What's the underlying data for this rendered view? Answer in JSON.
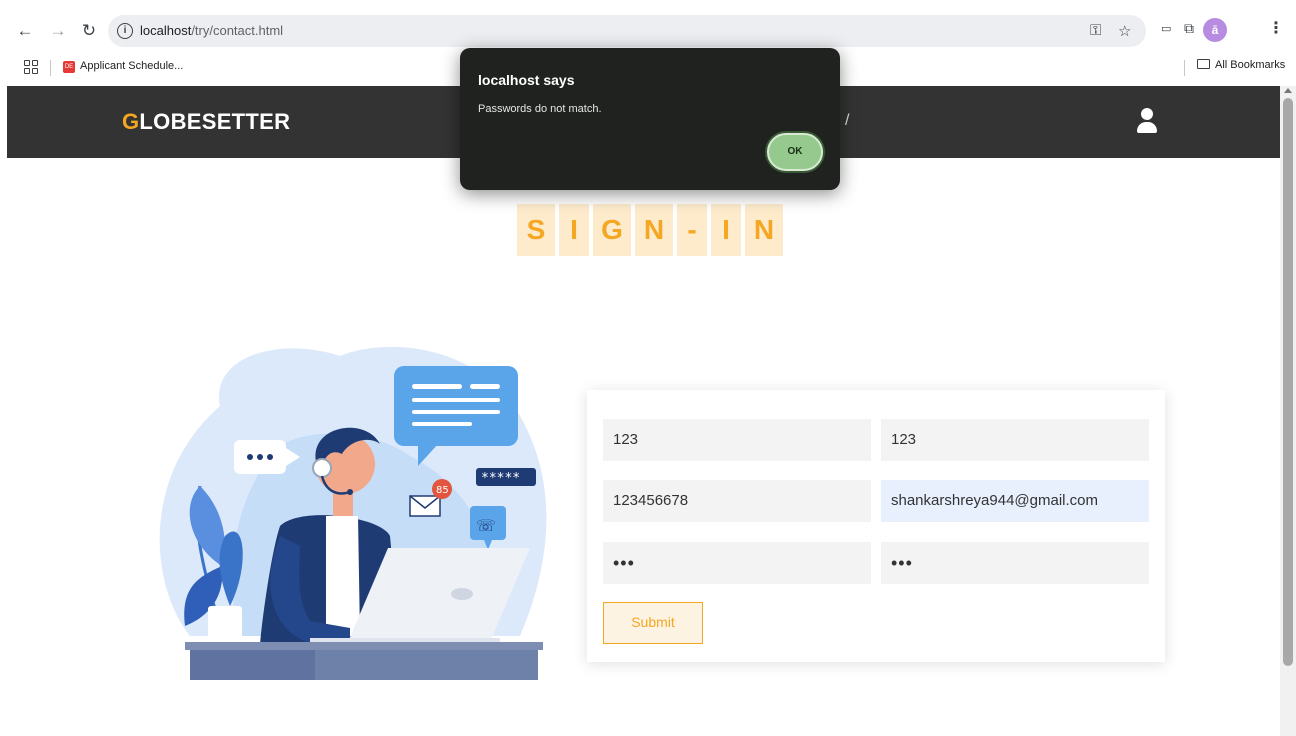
{
  "browser": {
    "url_host": "localhost",
    "url_path": "/try/contact.html",
    "bookmark_label": "Applicant Schedule...",
    "bookmark_favicon_text": "DE",
    "all_bookmarks_label": "All Bookmarks",
    "profile_initial": "ā",
    "icons": [
      "back-icon",
      "forward-icon",
      "reload-icon",
      "site-info-icon",
      "password-key-icon",
      "bookmark-star-icon",
      "extension-icon",
      "puzzle-icon",
      "more-menu-icon",
      "apps-grid-icon",
      "folder-icon"
    ]
  },
  "site": {
    "logo_first": "G",
    "logo_rest": "LOBESETTER",
    "nav_fragment": "/",
    "title_letters": [
      "S",
      "I",
      "G",
      "N",
      "-",
      "I",
      "N"
    ]
  },
  "form": {
    "field1": "123",
    "field2": "123",
    "field3": "123456678",
    "field4": "shankarshreya944@gmail.com",
    "field5": "•••",
    "field6": "•••",
    "submit_label": "Submit"
  },
  "dialog": {
    "title": "localhost says",
    "message": "Passwords do not match.",
    "ok_label": "OK"
  },
  "illustration": {
    "password_badge": "*****",
    "mail_badge_count": "85"
  },
  "colors": {
    "accent": "#f5a623",
    "header_bg": "#333333",
    "dialog_bg": "#1f221f",
    "ok_button": "#95c98d"
  }
}
